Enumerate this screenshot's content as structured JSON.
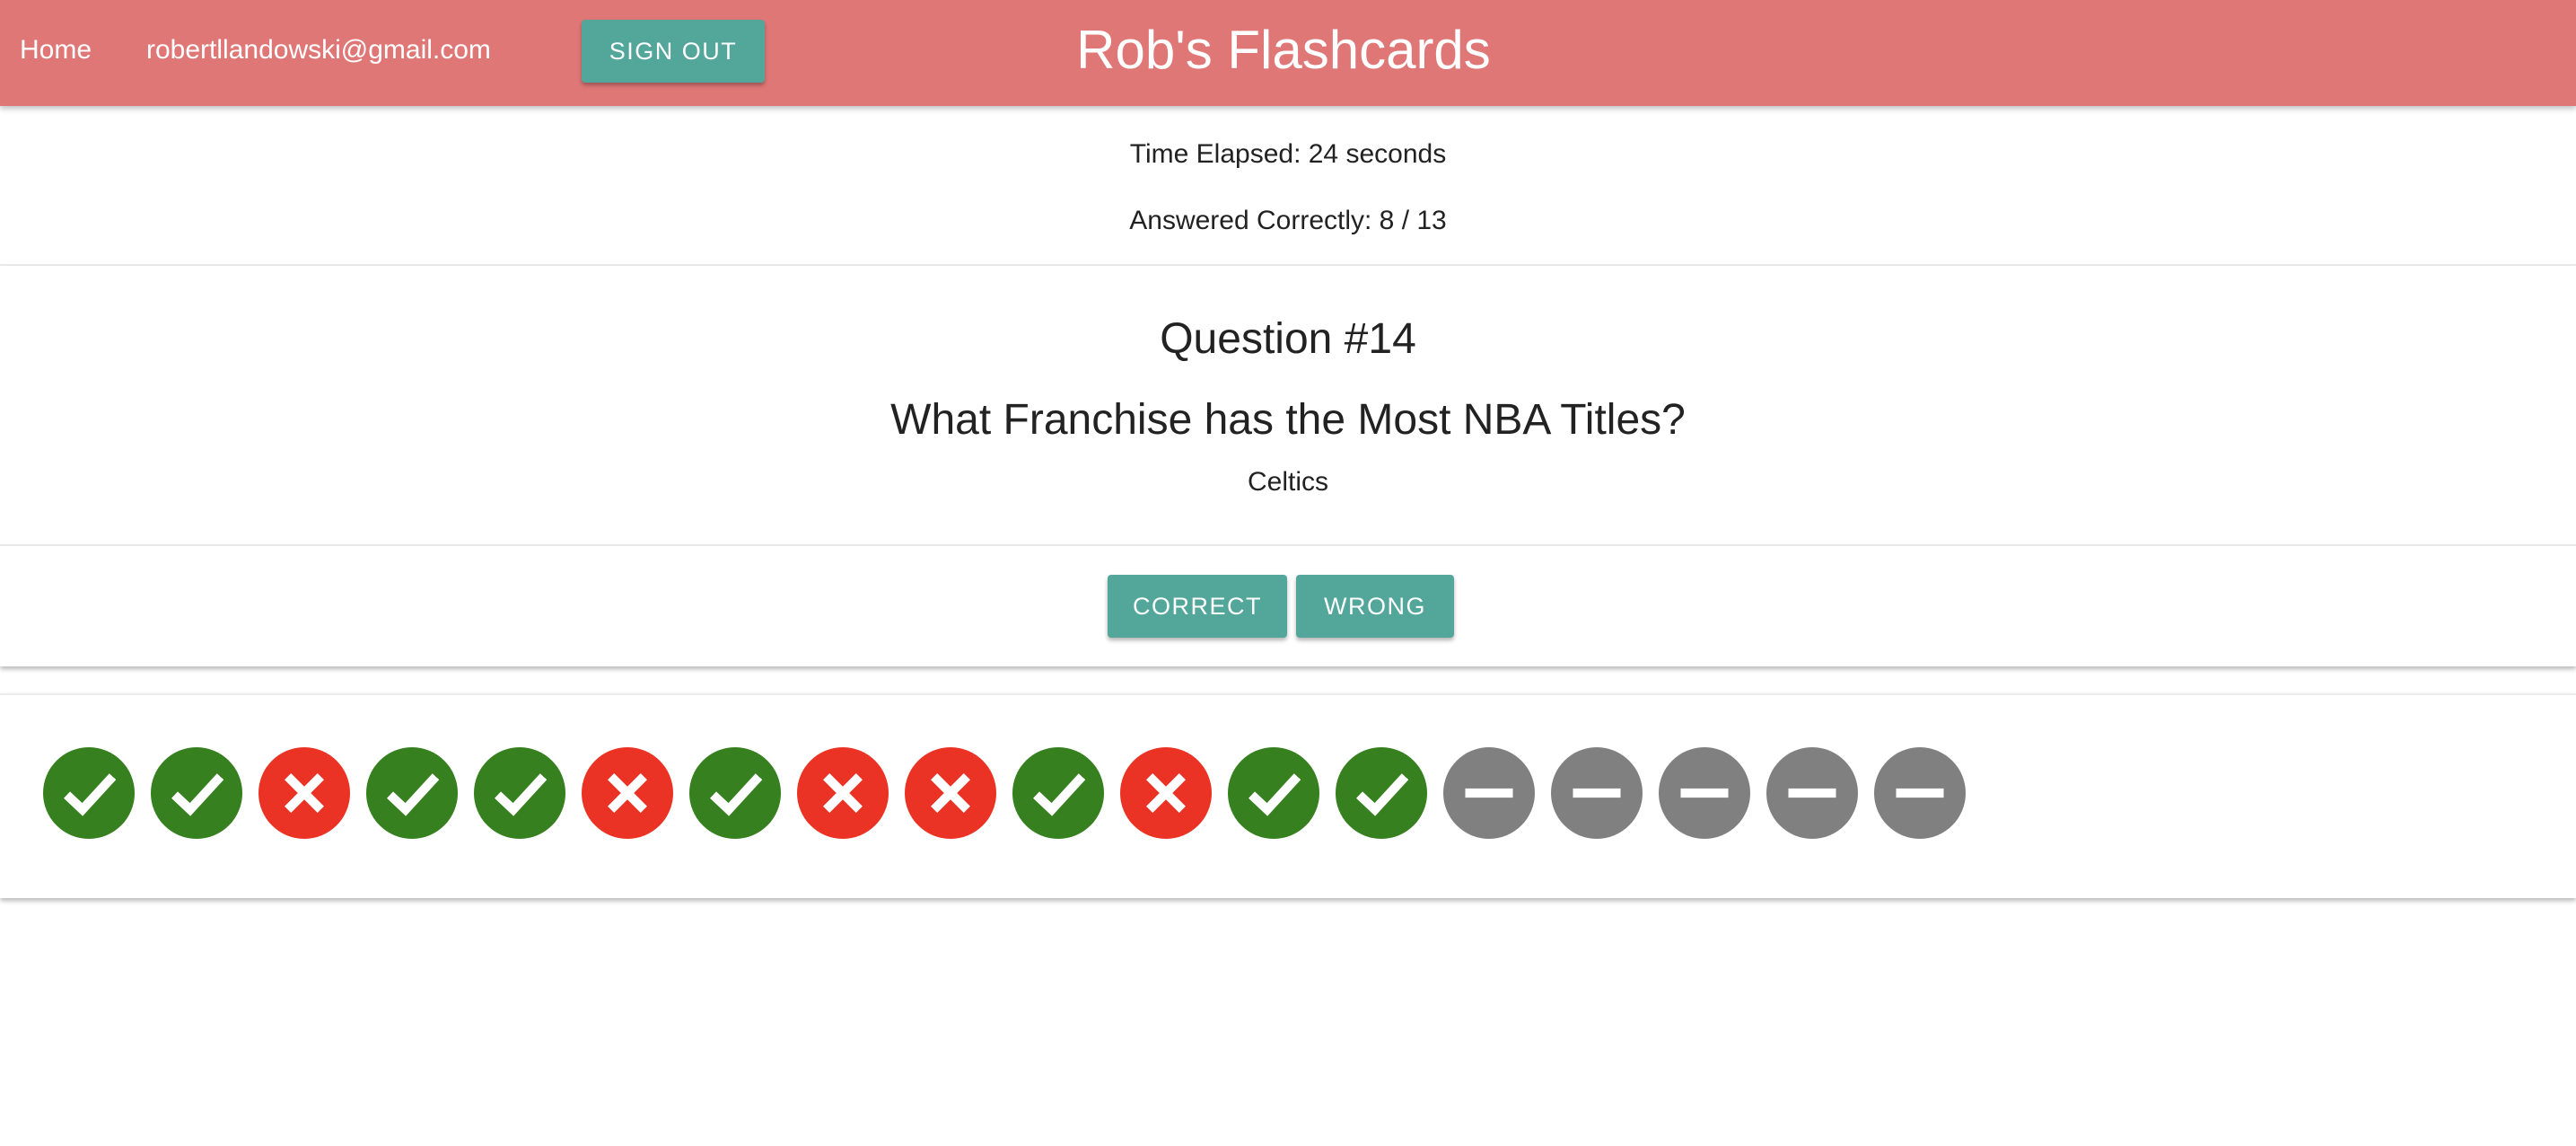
{
  "nav": {
    "home_label": "Home",
    "user_email": "robertllandowski@gmail.com",
    "signout_label": "SIGN OUT",
    "app_title": "Rob's Flashcards"
  },
  "stats": {
    "time_elapsed": "Time Elapsed: 24 seconds",
    "answered_correctly": "Answered Correctly: 8 / 13"
  },
  "question": {
    "number_label": "Question #14",
    "text": "What Franchise has the Most NBA Titles?",
    "answer": "Celtics"
  },
  "actions": {
    "correct_label": "CORRECT",
    "wrong_label": "WRONG"
  },
  "colors": {
    "appbar": "#e07777",
    "button": "#52a69a",
    "correct": "#36801f",
    "wrong": "#ea3324",
    "unanswered": "#808080"
  },
  "progress": [
    "correct",
    "correct",
    "wrong",
    "correct",
    "correct",
    "wrong",
    "correct",
    "wrong",
    "wrong",
    "correct",
    "wrong",
    "correct",
    "correct",
    "unanswered",
    "unanswered",
    "unanswered",
    "unanswered",
    "unanswered"
  ]
}
